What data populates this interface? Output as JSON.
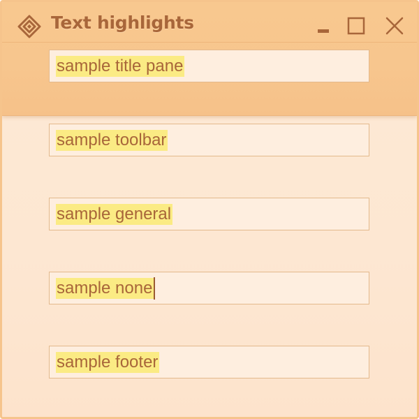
{
  "window": {
    "title": "Text highlights",
    "app_icon": "diamond-icon",
    "controls": {
      "minimize_icon": "minimize-icon",
      "maximize_icon": "maximize-icon",
      "close_icon": "close-icon"
    }
  },
  "fields": {
    "title_pane": "sample title pane",
    "toolbar": "sample toolbar",
    "general": "sample general",
    "none": "sample none",
    "footer": "sample footer"
  },
  "colors": {
    "title_pane_bg": "#f7c68e",
    "body_bg": "#fde7d2",
    "text": "#a8663a",
    "highlight": "#fbeb84",
    "field_bg": "#feeedf",
    "field_border": "#e3b98c",
    "window_border": "#f6c48c"
  }
}
